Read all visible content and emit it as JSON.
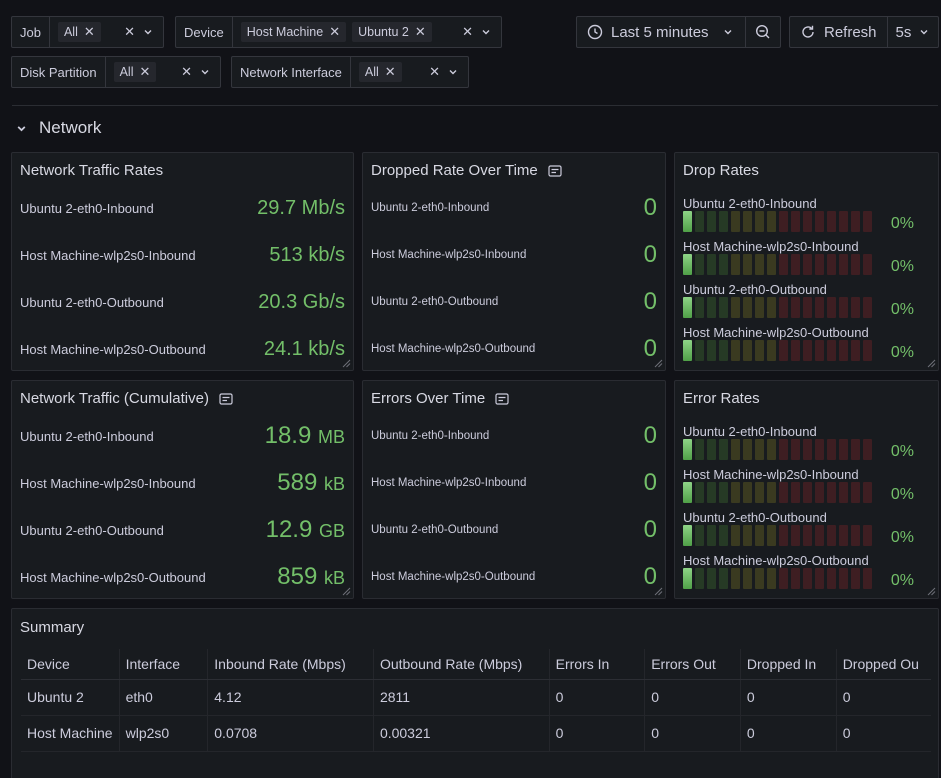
{
  "variables": {
    "job": {
      "label": "Job",
      "values": [
        "All"
      ]
    },
    "device": {
      "label": "Device",
      "values": [
        "Host Machine",
        "Ubuntu 2"
      ]
    },
    "disk_partition": {
      "label": "Disk Partition",
      "values": [
        "All"
      ]
    },
    "network_interface": {
      "label": "Network Interface",
      "values": [
        "All"
      ]
    }
  },
  "time_picker": {
    "label": "Last 5 minutes"
  },
  "refresh": {
    "label": "Refresh",
    "interval": "5s"
  },
  "row": {
    "title": "Network"
  },
  "panels": {
    "traffic_rates": {
      "title": "Network Traffic Rates",
      "rows": [
        {
          "name": "Ubuntu 2-eth0-Inbound",
          "value": "29.7 Mb/s"
        },
        {
          "name": "Host Machine-wlp2s0-Inbound",
          "value": "513 kb/s"
        },
        {
          "name": "Ubuntu 2-eth0-Outbound",
          "value": "20.3 Gb/s"
        },
        {
          "name": "Host Machine-wlp2s0-Outbound",
          "value": "24.1 kb/s"
        }
      ]
    },
    "dropped_rate": {
      "title": "Dropped Rate Over Time",
      "rows": [
        {
          "name": "Ubuntu 2-eth0-Inbound",
          "value": "0"
        },
        {
          "name": "Host Machine-wlp2s0-Inbound",
          "value": "0"
        },
        {
          "name": "Ubuntu 2-eth0-Outbound",
          "value": "0"
        },
        {
          "name": "Host Machine-wlp2s0-Outbound",
          "value": "0"
        }
      ]
    },
    "drop_rates": {
      "title": "Drop Rates",
      "rows": [
        {
          "name": "Ubuntu 2-eth0-Inbound",
          "value": "0%",
          "level": 0
        },
        {
          "name": "Host Machine-wlp2s0-Inbound",
          "value": "0%",
          "level": 0
        },
        {
          "name": "Ubuntu 2-eth0-Outbound",
          "value": "0%",
          "level": 0
        },
        {
          "name": "Host Machine-wlp2s0-Outbound",
          "value": "0%",
          "level": 0
        }
      ]
    },
    "traffic_cumulative": {
      "title": "Network Traffic (Cumulative)",
      "rows": [
        {
          "name": "Ubuntu 2-eth0-Inbound",
          "number": "18.9",
          "unit": "MB"
        },
        {
          "name": "Host Machine-wlp2s0-Inbound",
          "number": "589",
          "unit": "kB"
        },
        {
          "name": "Ubuntu 2-eth0-Outbound",
          "number": "12.9",
          "unit": "GB"
        },
        {
          "name": "Host Machine-wlp2s0-Outbound",
          "number": "859",
          "unit": "kB"
        }
      ]
    },
    "errors_over_time": {
      "title": "Errors Over Time",
      "rows": [
        {
          "name": "Ubuntu 2-eth0-Inbound",
          "value": "0"
        },
        {
          "name": "Host Machine-wlp2s0-Inbound",
          "value": "0"
        },
        {
          "name": "Ubuntu 2-eth0-Outbound",
          "value": "0"
        },
        {
          "name": "Host Machine-wlp2s0-Outbound",
          "value": "0"
        }
      ]
    },
    "error_rates": {
      "title": "Error Rates",
      "rows": [
        {
          "name": "Ubuntu 2-eth0-Inbound",
          "value": "0%",
          "level": 0
        },
        {
          "name": "Host Machine-wlp2s0-Inbound",
          "value": "0%",
          "level": 0
        },
        {
          "name": "Ubuntu 2-eth0-Outbound",
          "value": "0%",
          "level": 0
        },
        {
          "name": "Host Machine-wlp2s0-Outbound",
          "value": "0%",
          "level": 0
        }
      ]
    },
    "summary": {
      "title": "Summary",
      "columns": [
        "Device",
        "Interface",
        "Inbound Rate (Mbps)",
        "Outbound Rate (Mbps)",
        "Errors In",
        "Errors Out",
        "Dropped In",
        "Dropped Ou"
      ],
      "rows": [
        [
          "Ubuntu 2",
          "eth0",
          "4.12",
          "2811",
          "0",
          "0",
          "0",
          "0"
        ],
        [
          "Host Machine",
          "wlp2s0",
          "0.0708",
          "0.00321",
          "0",
          "0",
          "0",
          "0"
        ]
      ]
    }
  },
  "colors": {
    "value_green": "#73bf69",
    "bg": "#111217",
    "panel": "#181b1f"
  },
  "icons": [
    "close-icon",
    "chevron-down-icon",
    "clock-icon",
    "zoom-out-icon",
    "refresh-icon",
    "chevron-right-icon",
    "info-icon",
    "resize-handle-icon"
  ]
}
